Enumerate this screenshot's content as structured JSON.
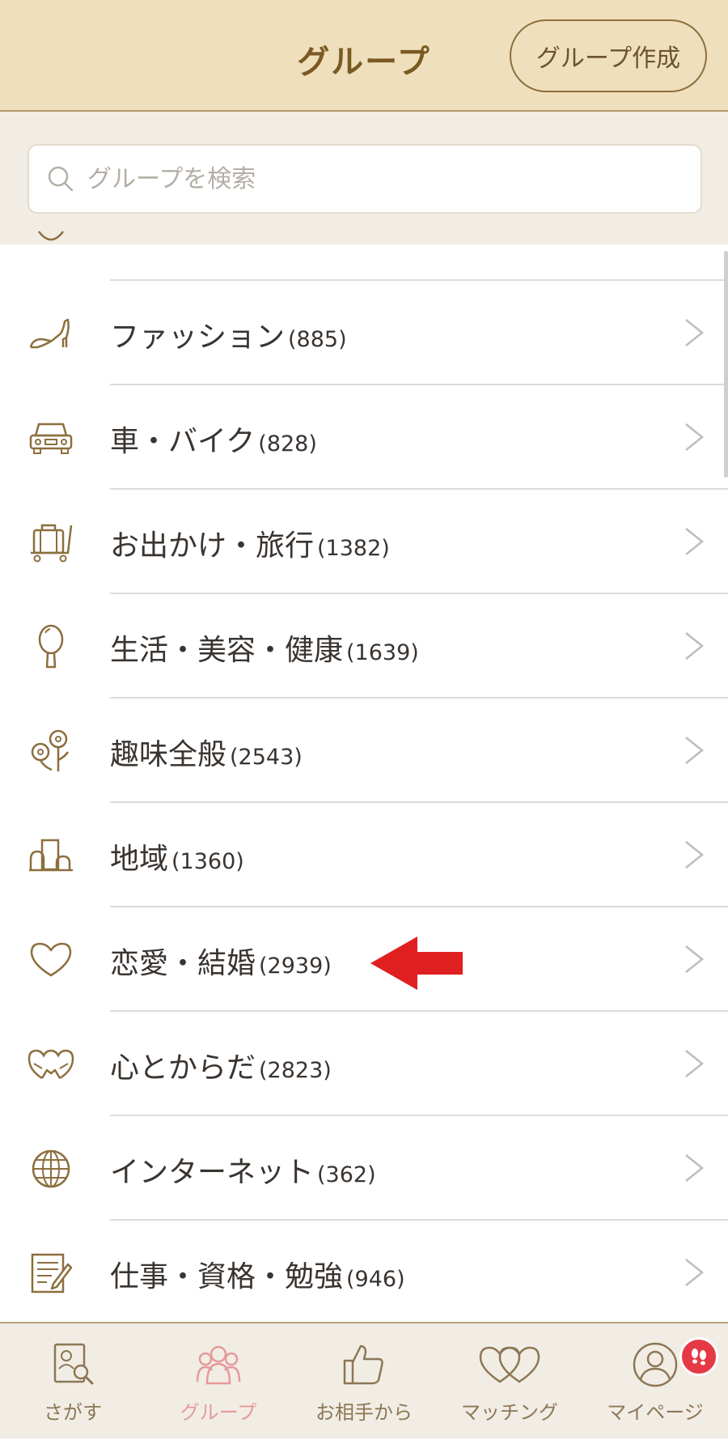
{
  "header": {
    "title": "グループ",
    "create_button": "グループ作成"
  },
  "search": {
    "placeholder": "グループを検索"
  },
  "categories": [
    {
      "icon": "high-heel-icon",
      "label": "ファッション",
      "count": "(885)"
    },
    {
      "icon": "car-icon",
      "label": "車・バイク",
      "count": "(828)"
    },
    {
      "icon": "luggage-cart-icon",
      "label": "お出かけ・旅行",
      "count": "(1382)"
    },
    {
      "icon": "hand-mirror-icon",
      "label": "生活・美容・健康",
      "count": "(1639)"
    },
    {
      "icon": "flowers-icon",
      "label": "趣味全般",
      "count": "(2543)"
    },
    {
      "icon": "town-icon",
      "label": "地域",
      "count": "(1360)"
    },
    {
      "icon": "heart-icon",
      "label": "恋愛・結婚",
      "count": "(2939)"
    },
    {
      "icon": "hearts-holding-hands-icon",
      "label": "心とからだ",
      "count": "(2823)"
    },
    {
      "icon": "globe-icon",
      "label": "インターネット",
      "count": "(362)"
    },
    {
      "icon": "notepad-pencil-icon",
      "label": "仕事・資格・勉強",
      "count": "(946)"
    }
  ],
  "tabs": [
    {
      "icon": "profile-search-icon",
      "label": "さがす",
      "active": false
    },
    {
      "icon": "group-people-icon",
      "label": "グループ",
      "active": true
    },
    {
      "icon": "thumbs-up-icon",
      "label": "お相手から",
      "active": false
    },
    {
      "icon": "double-heart-icon",
      "label": "マッチング",
      "active": false
    },
    {
      "icon": "person-circle-icon",
      "label": "マイページ",
      "active": false
    }
  ],
  "colors": {
    "header_bg": "#f0dfbc",
    "accent_brown": "#8c6f3e",
    "active_tab": "#e49a9a",
    "annotation_arrow": "#e02020",
    "badge": "#e63946"
  }
}
